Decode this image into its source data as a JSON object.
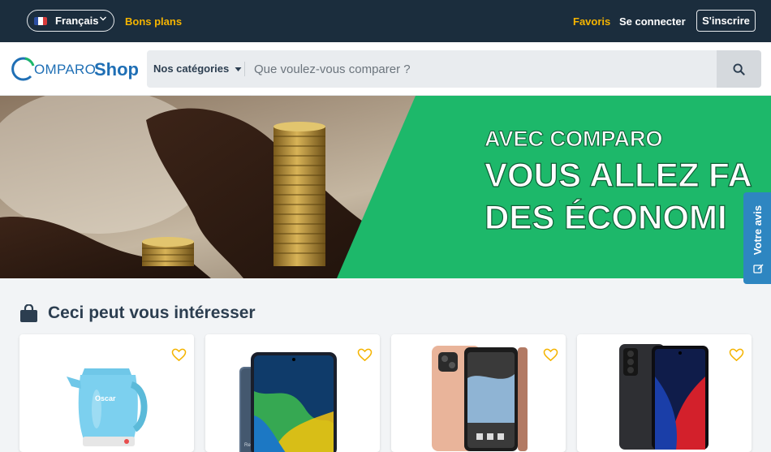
{
  "topbar": {
    "language": "Français",
    "deals_label": "Bons plans",
    "favorites_label": "Favoris",
    "login_label": "Se connecter",
    "signup_label": "S'inscrire"
  },
  "header": {
    "logo": {
      "main": "OMPARO",
      "shop": "Shop"
    },
    "categories_label": "Nos catégories",
    "search_placeholder": "Que voulez-vous comparer ?"
  },
  "banner": {
    "line1": "AVEC COMPARO",
    "line2": "VOUS ALLEZ FA",
    "line3": "DES ÉCONOMI"
  },
  "feedback": {
    "label": "Votre avis"
  },
  "section": {
    "title": "Ceci peut vous intéresser"
  },
  "products": [
    {
      "kind": "kettle",
      "brand": "Oscar"
    },
    {
      "kind": "phone-redmi",
      "brand": "Redmi"
    },
    {
      "kind": "phone-itel"
    },
    {
      "kind": "phone-infinix"
    }
  ],
  "colors": {
    "topbar_bg": "#1b2d3d",
    "accent_yellow": "#f5b400",
    "brand_blue": "#1f6fb5",
    "banner_green": "#1db86a",
    "feedback_blue": "#2e86c1"
  },
  "icons": [
    "chevron-down-icon",
    "caret-down-icon",
    "search-icon",
    "shopping-bag-icon",
    "heart-icon",
    "edit-icon"
  ]
}
